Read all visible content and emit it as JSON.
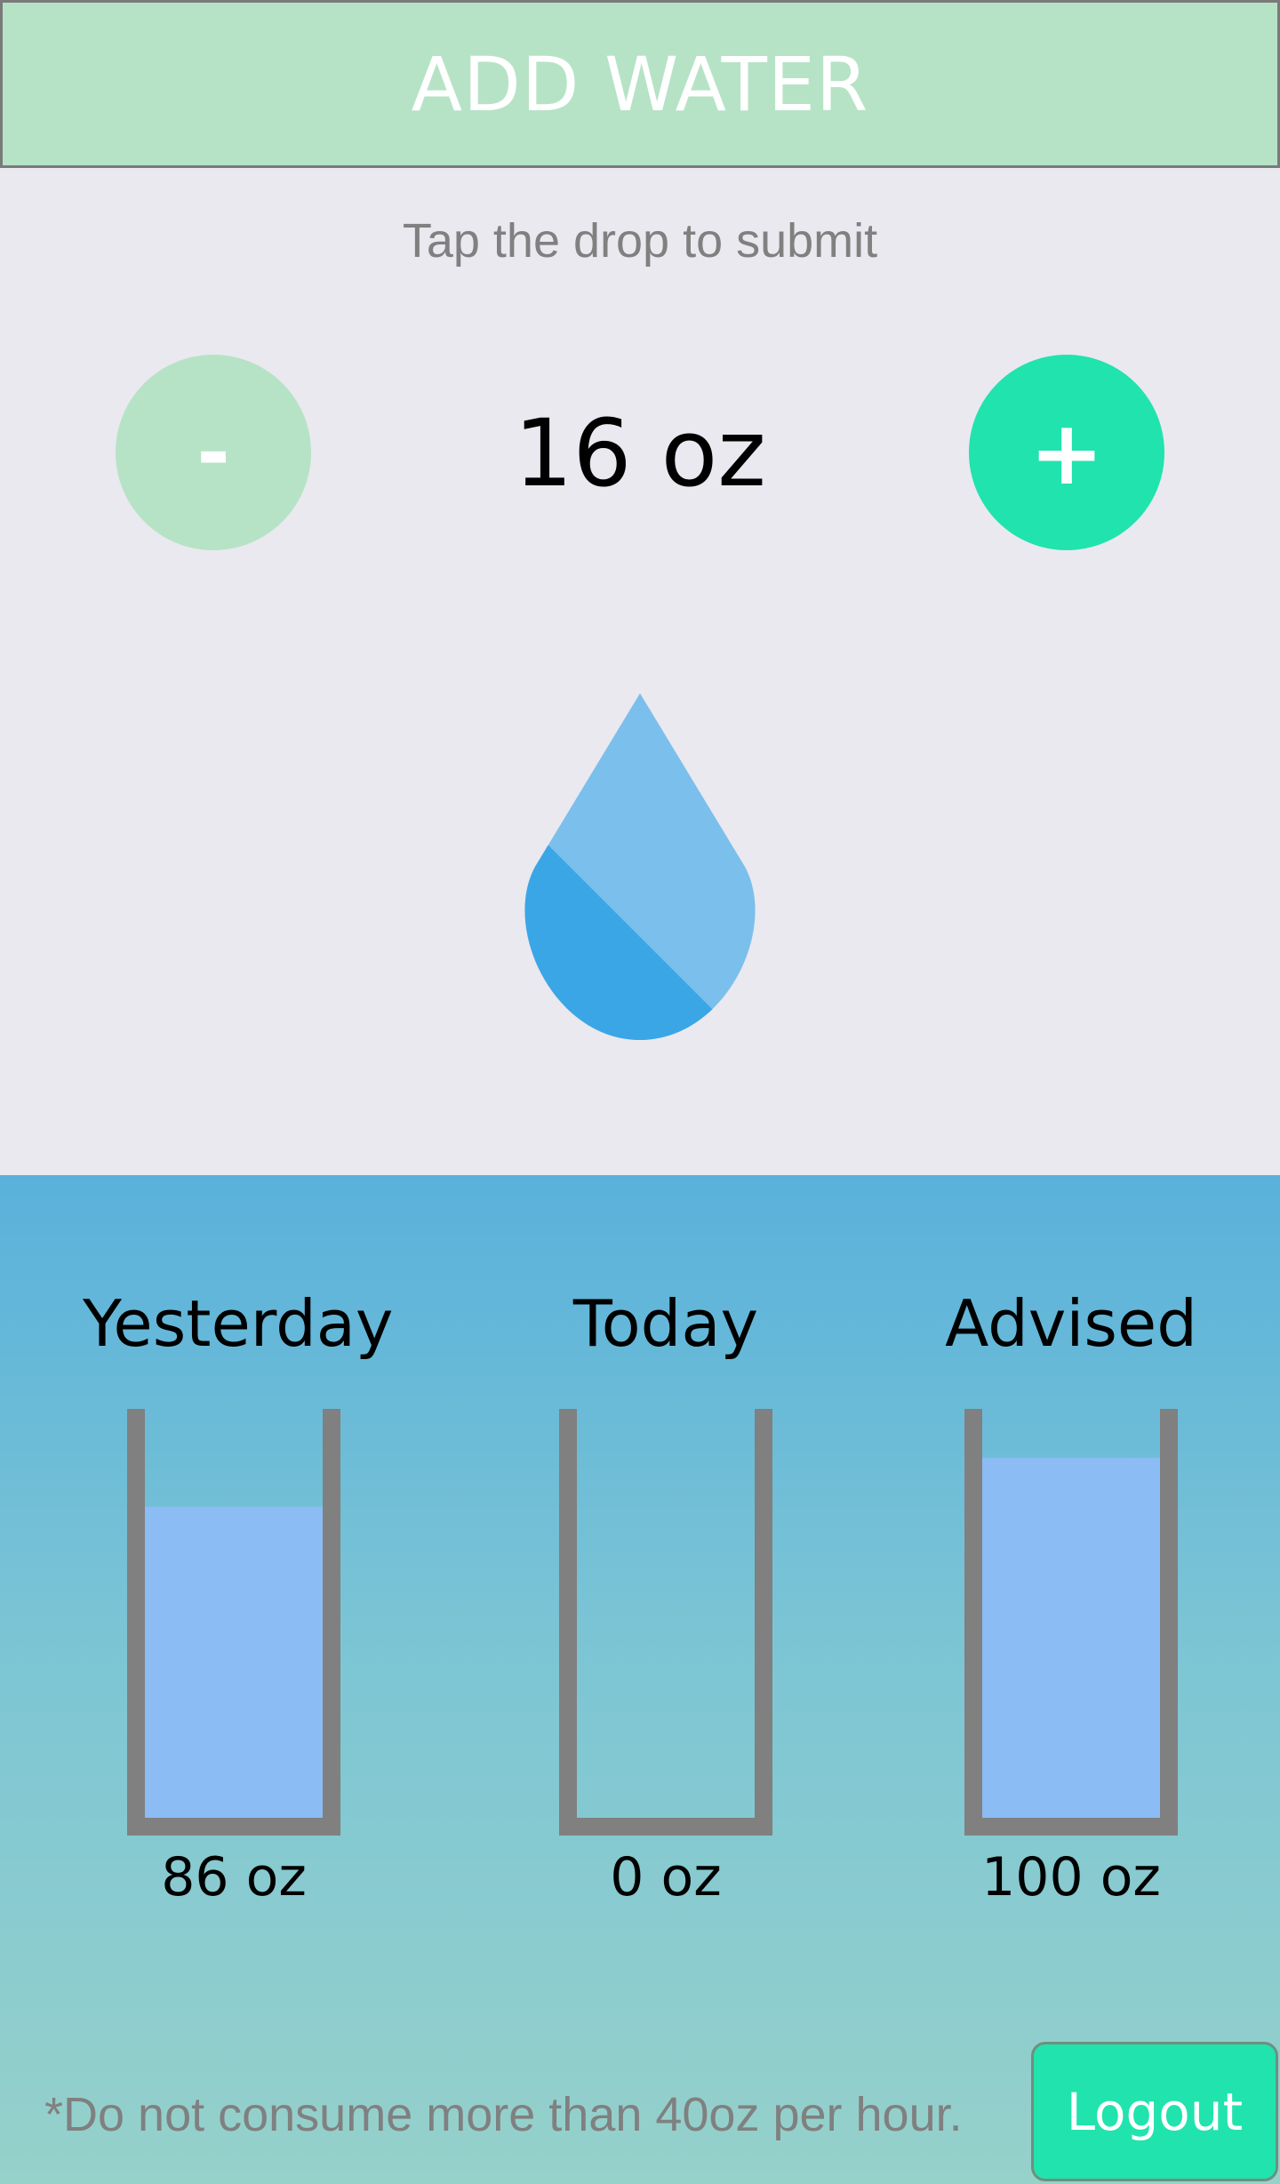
{
  "header": {
    "title": "ADD WATER"
  },
  "hint": "Tap the drop to submit",
  "controls": {
    "minus_label": "-",
    "plus_label": "+",
    "amount": "16 oz"
  },
  "drop": {
    "icon": "water-drop-icon",
    "light_color": "#7bbfec",
    "dark_color": "#3ba6e6"
  },
  "stats": [
    {
      "title": "Yesterday",
      "value": "86 oz",
      "fill_fraction": 0.76
    },
    {
      "title": "Today",
      "value": "0 oz",
      "fill_fraction": 0
    },
    {
      "title": "Advised",
      "value": "100 oz",
      "fill_fraction": 0.88
    }
  ],
  "footer": {
    "note": "*Do not consume more than 40oz per hour.",
    "logout_label": "Logout"
  },
  "colors": {
    "header_bg": "#b6e3c6",
    "accent": "#21e3ad",
    "water_fill": "#8bbcf3"
  }
}
